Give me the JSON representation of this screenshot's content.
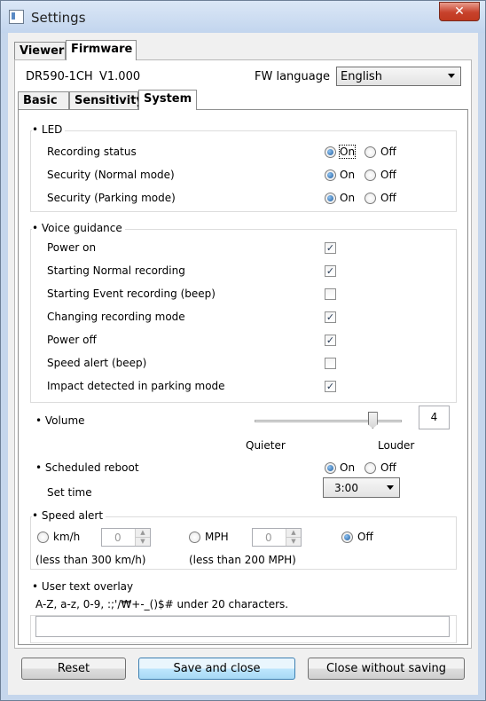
{
  "window": {
    "title": "Settings",
    "close_glyph": "✕"
  },
  "top_tabs": [
    "Viewer",
    "Firmware"
  ],
  "device": {
    "model": "DR590-1CH",
    "version": "V1.000"
  },
  "fw_language": {
    "label": "FW language",
    "value": "English"
  },
  "sub_tabs": [
    "Basic",
    "Sensitivity",
    "System"
  ],
  "led": {
    "title": "LED",
    "rows": [
      {
        "label": "Recording status",
        "value": "On"
      },
      {
        "label": "Security (Normal mode)",
        "value": "On"
      },
      {
        "label": "Security (Parking mode)",
        "value": "On"
      }
    ],
    "on_label": "On",
    "off_label": "Off"
  },
  "voice": {
    "title": "Voice guidance",
    "items": [
      {
        "label": "Power on",
        "checked": true
      },
      {
        "label": "Starting Normal recording",
        "checked": true
      },
      {
        "label": "Starting Event recording (beep)",
        "checked": false
      },
      {
        "label": "Changing recording mode",
        "checked": true
      },
      {
        "label": "Power off",
        "checked": true
      },
      {
        "label": "Speed alert (beep)",
        "checked": false
      },
      {
        "label": "Impact detected in parking mode",
        "checked": true
      }
    ]
  },
  "volume": {
    "title": "Volume",
    "value": "4",
    "level_fraction": 0.8,
    "min_label": "Quieter",
    "max_label": "Louder"
  },
  "reboot": {
    "title": "Scheduled reboot",
    "value": "On",
    "on_label": "On",
    "off_label": "Off",
    "set_time_label": "Set time",
    "set_time_value": "3:00"
  },
  "speed_alert": {
    "title": "Speed alert",
    "kmh_label": "km/h",
    "kmh_value": "0",
    "kmh_note": "(less than 300 km/h)",
    "mph_label": "MPH",
    "mph_value": "0",
    "mph_note": "(less than 200 MPH)",
    "off_label": "Off",
    "selected": "Off"
  },
  "overlay": {
    "title": "User text overlay",
    "hint": "A-Z, a-z, 0-9, :;'/₩+-_()$# under 20 characters.",
    "value": ""
  },
  "buttons": {
    "reset": "Reset",
    "save": "Save and close",
    "close": "Close without saving"
  }
}
